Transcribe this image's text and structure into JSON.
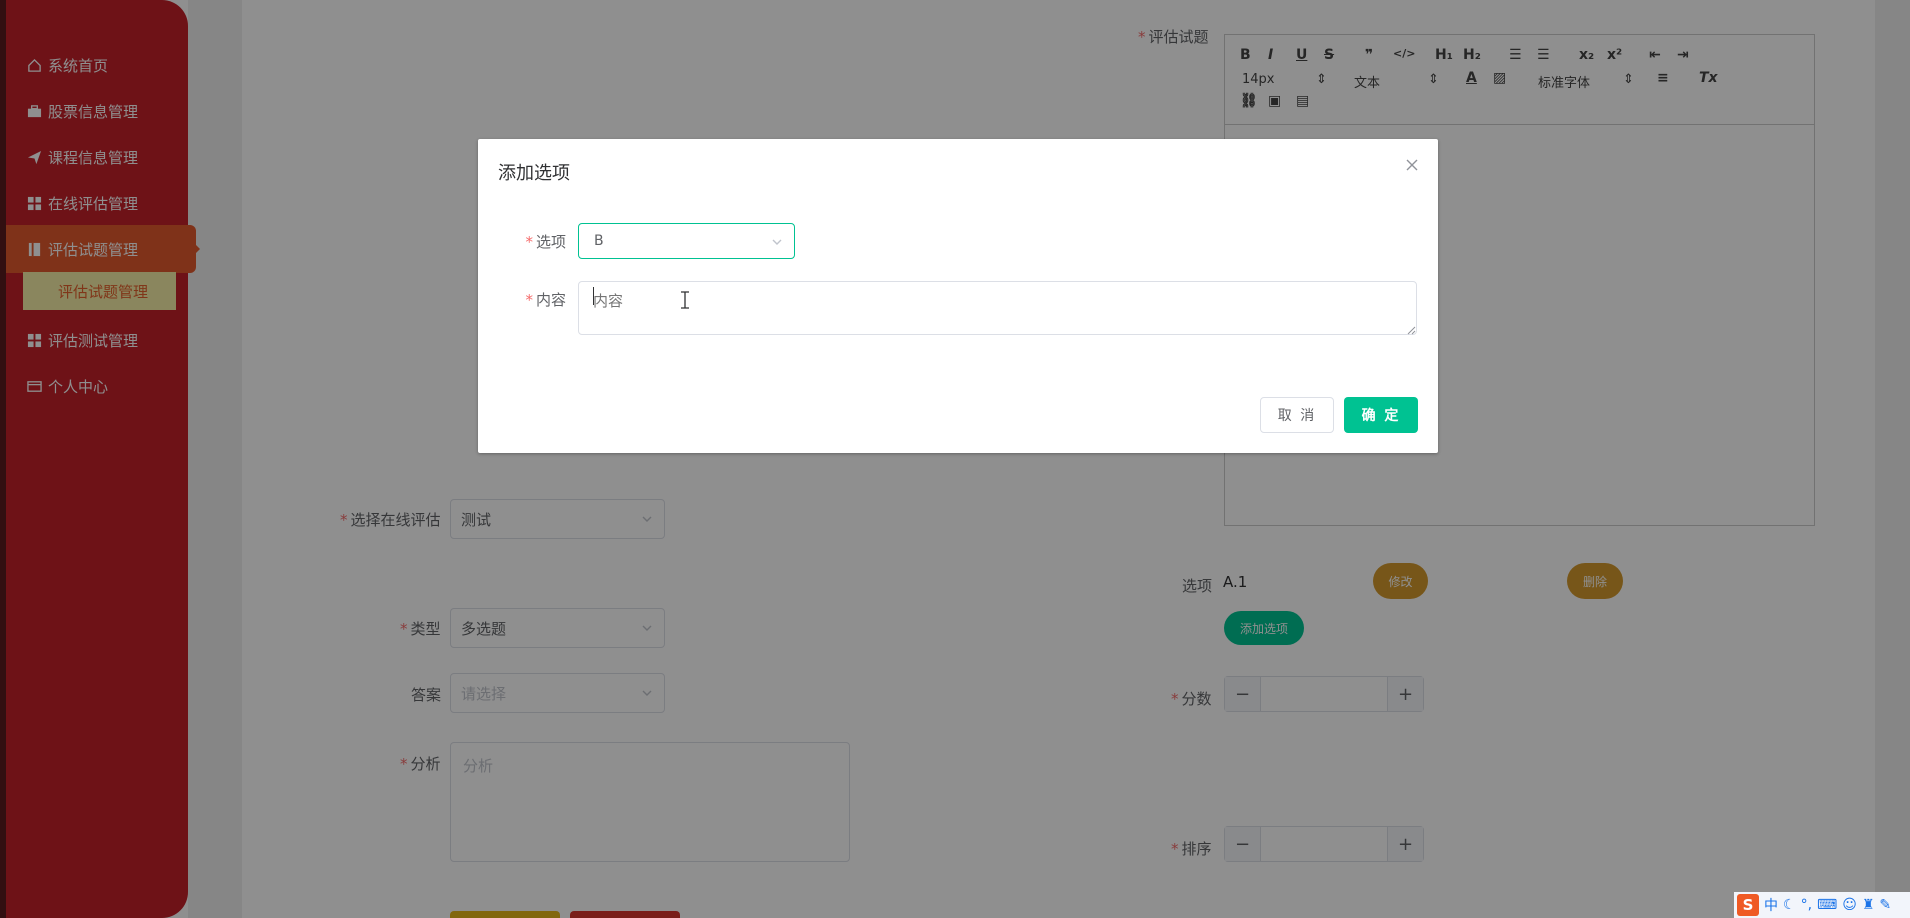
{
  "sidebar": {
    "items": [
      {
        "label": "系统首页",
        "icon": "home-icon"
      },
      {
        "label": "股票信息管理",
        "icon": "briefcase-icon"
      },
      {
        "label": "课程信息管理",
        "icon": "paper-plane-icon"
      },
      {
        "label": "在线评估管理",
        "icon": "grid-icon"
      },
      {
        "label": "评估试题管理",
        "icon": "book-icon"
      },
      {
        "label": "评估测试管理",
        "icon": "grid-icon"
      },
      {
        "label": "个人中心",
        "icon": "card-icon"
      }
    ],
    "sub_item": "评估试题管理",
    "active_index": 4
  },
  "form": {
    "question_label": "评估试题",
    "assessment_label": "选择在线评估",
    "assessment_value": "测试",
    "type_label": "类型",
    "type_value": "多选题",
    "answer_label": "答案",
    "answer_placeholder": "请选择",
    "analysis_label": "分析",
    "analysis_placeholder": "分析",
    "options_label": "选项",
    "existing_option": "A.1",
    "edit_label": "修改",
    "delete_label": "删除",
    "add_option_label": "添加选项",
    "score_label": "分数",
    "sort_label": "排序"
  },
  "editor_toolbar": {
    "font_size": "14px",
    "text_style": "文本",
    "font_family": "标准字体",
    "buttons_row1": [
      "B",
      "I",
      "U",
      "S",
      "❞",
      "</>",
      "H1",
      "H2",
      "ol",
      "ul",
      "x₂",
      "x²",
      "outdent",
      "indent"
    ],
    "buttons_row2": [
      "A",
      "bg",
      "align",
      "Tx"
    ],
    "buttons_row3": [
      "link",
      "image",
      "video"
    ]
  },
  "dialog": {
    "title": "添加选项",
    "option_label": "选项",
    "option_value": "B",
    "content_label": "内容",
    "content_placeholder": "内容",
    "cancel_label": "取 消",
    "confirm_label": "确 定"
  },
  "ime": {
    "logo": "S",
    "mode": "中"
  },
  "colors": {
    "sidebar": "#c4202a",
    "active": "#e25a2e",
    "primary": "#00c292",
    "pill_orange": "#d49a2e",
    "required": "#f56c6c"
  }
}
